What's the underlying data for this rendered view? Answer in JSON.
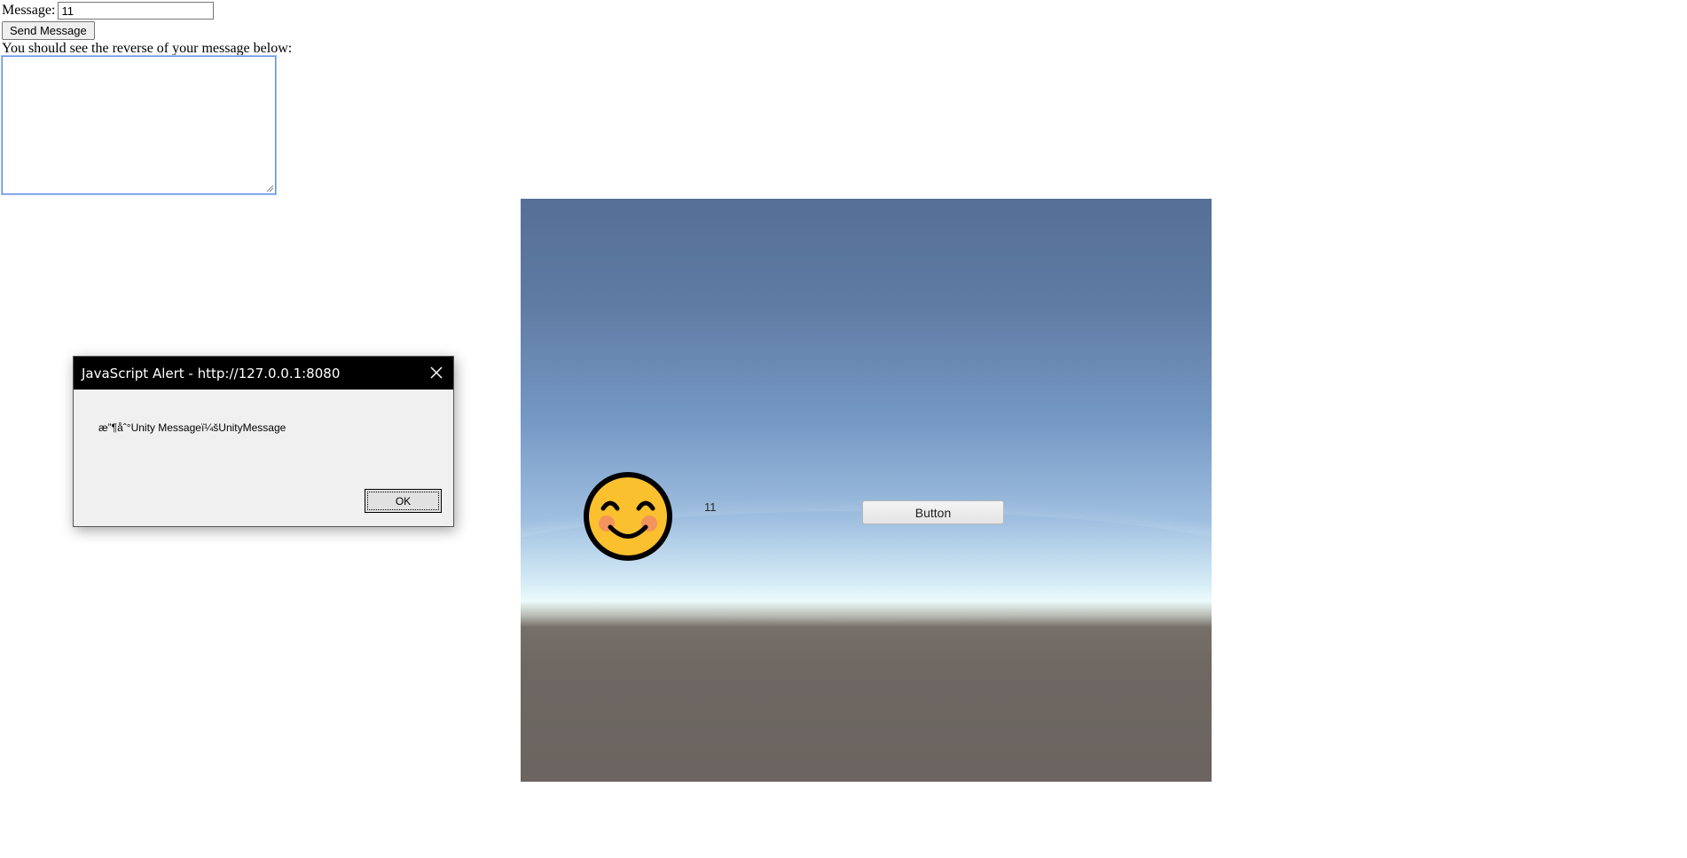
{
  "form": {
    "message_label": "Message:",
    "message_value": "11",
    "send_button_label": "Send Message",
    "reverse_hint": "You should see the reverse of your message below:",
    "output_value": ""
  },
  "unity": {
    "label_text": "11",
    "button_label": "Button",
    "smiley_icon": "smiling-face-icon",
    "colors": {
      "sky_top": "#566f96",
      "horizon": "#ecfbfb",
      "ground": "#6b6460",
      "smiley_fill": "#fbc02d"
    }
  },
  "alert": {
    "title": "JavaScript Alert - http://127.0.0.1:8080",
    "message": "æ”¶åˆ°Unity Messageï¼šUnityMessage",
    "ok_label": "OK",
    "close_icon": "close-icon"
  }
}
